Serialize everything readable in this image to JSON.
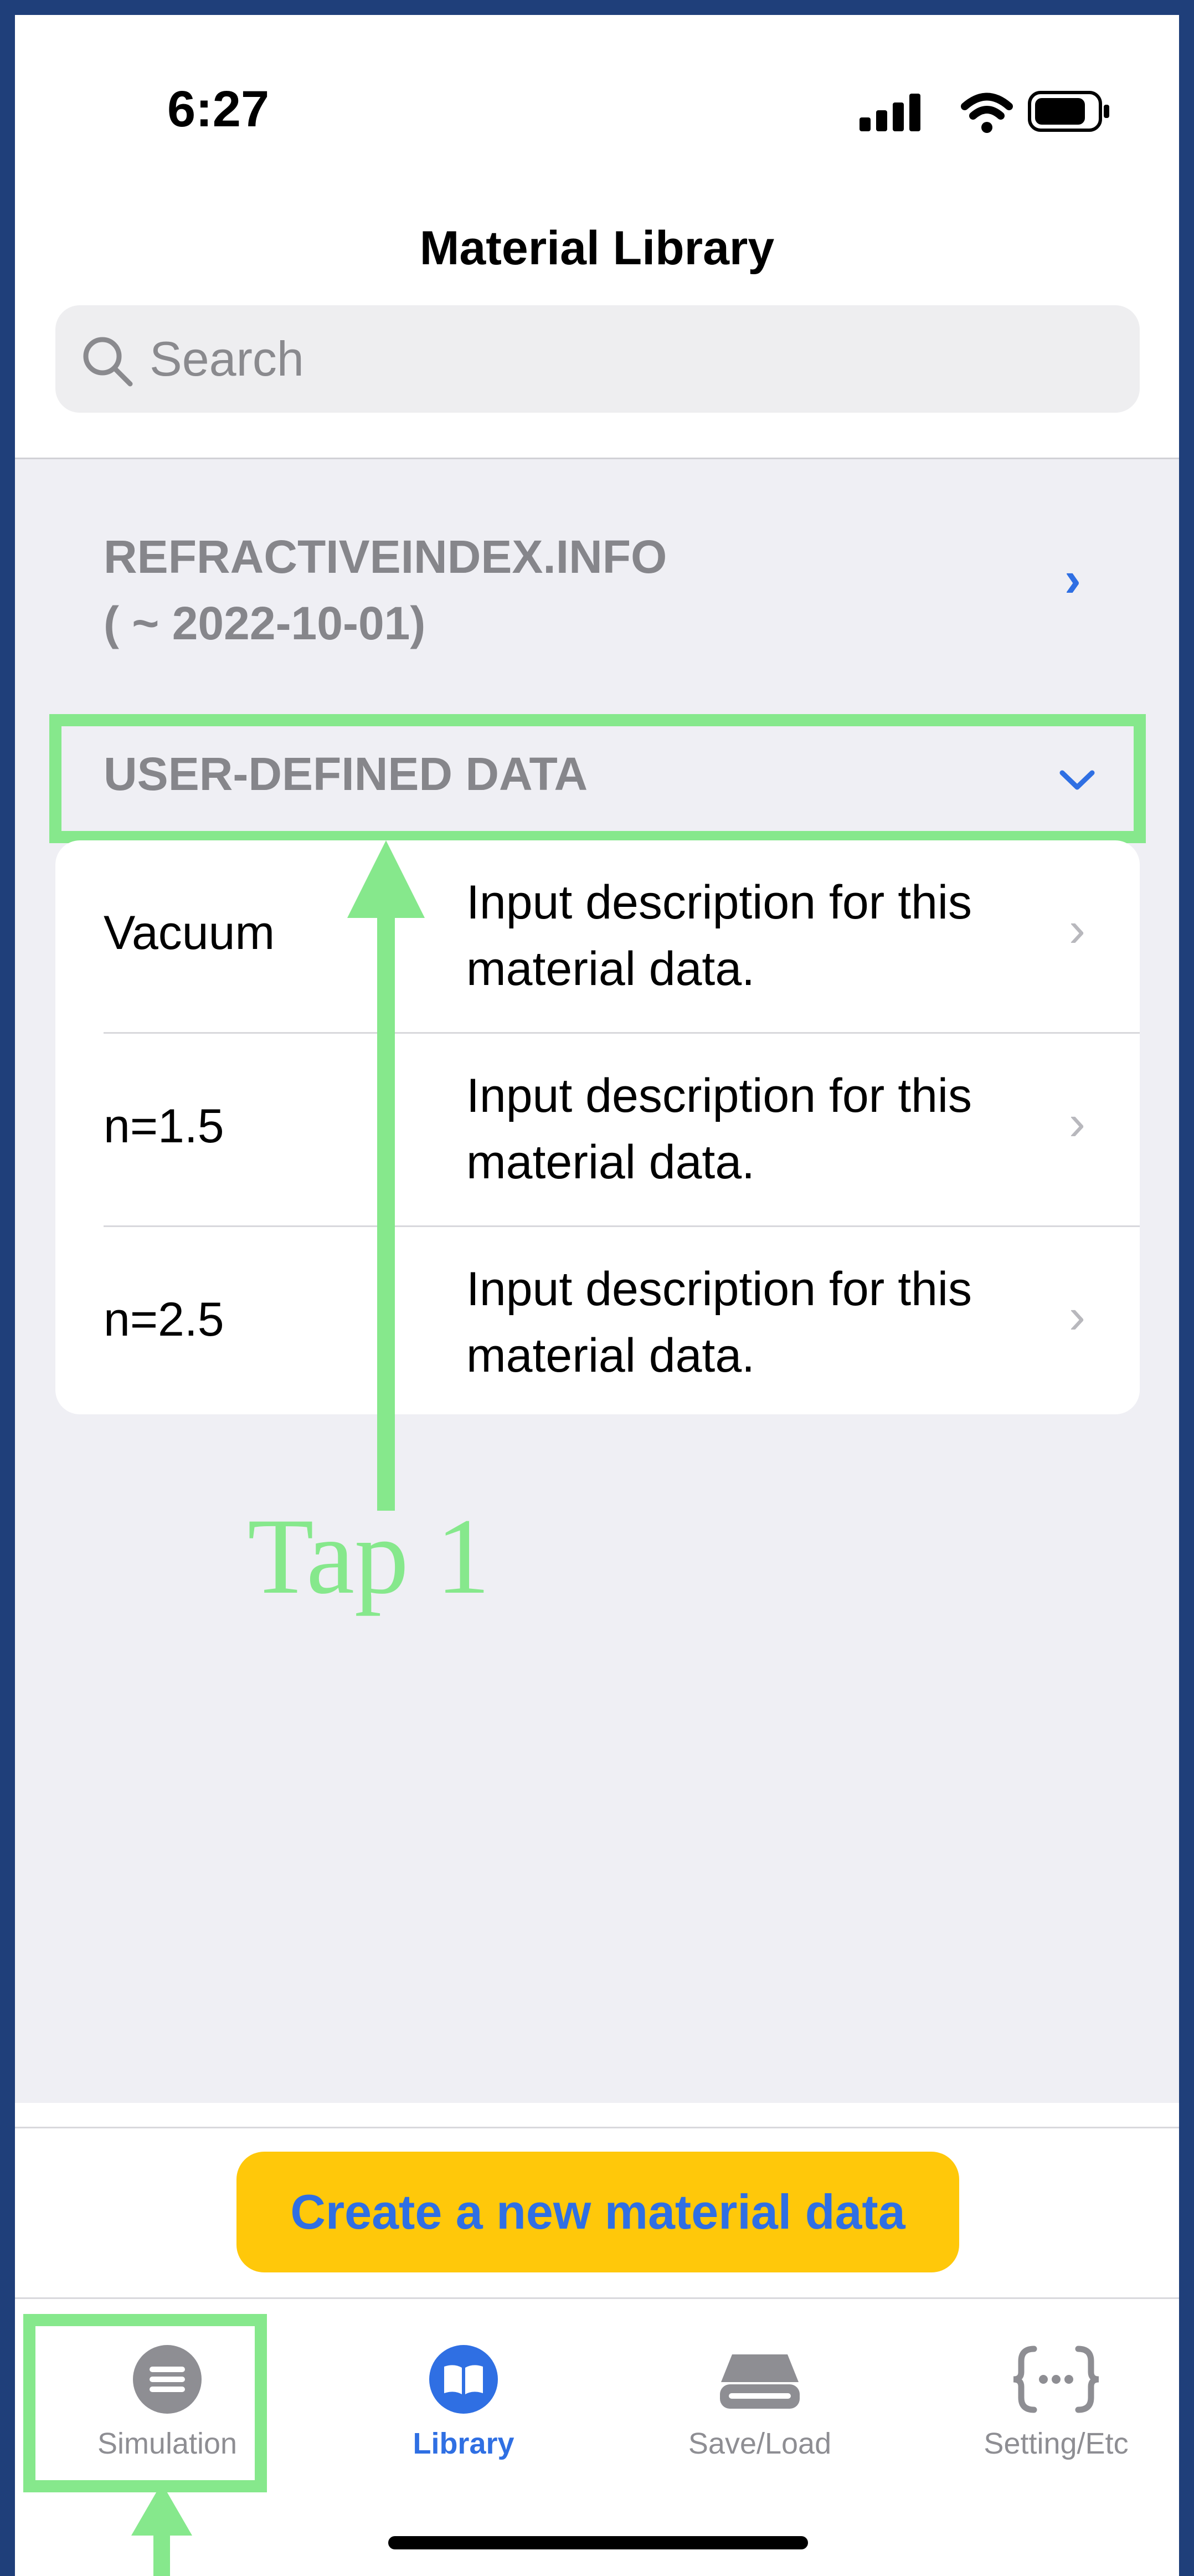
{
  "status_bar": {
    "time": "6:27"
  },
  "header": {
    "title": "Material Library"
  },
  "search": {
    "placeholder": "Search"
  },
  "sections": {
    "refractive_index": {
      "line1": "REFRACTIVEINDEX.INFO",
      "line2": "( ~ 2022-10-01)"
    },
    "user_defined": {
      "label": "USER-DEFINED DATA"
    }
  },
  "materials": [
    {
      "name": "Vacuum",
      "description": "Input description for this material data."
    },
    {
      "name": "n=1.5",
      "description": "Input description for this material data."
    },
    {
      "name": "n=2.5",
      "description": "Input description for this material data."
    }
  ],
  "annotation": {
    "tap_label": "Tap 1"
  },
  "actions": {
    "create_label": "Create a new material data"
  },
  "tabs": [
    {
      "label": "Simulation",
      "icon": "list-icon",
      "active": false
    },
    {
      "label": "Library",
      "icon": "book-icon",
      "active": true
    },
    {
      "label": "Save/Load",
      "icon": "drive-icon",
      "active": false
    },
    {
      "label": "Setting/Etc",
      "icon": "curly-braces-icon",
      "active": false
    }
  ],
  "colors": {
    "accent": "#2f6fe3",
    "button_bg": "#ffc80a",
    "highlight": "#86e88c",
    "frame": "#1f3f7a",
    "inactive_tab": "#8e8e93"
  }
}
